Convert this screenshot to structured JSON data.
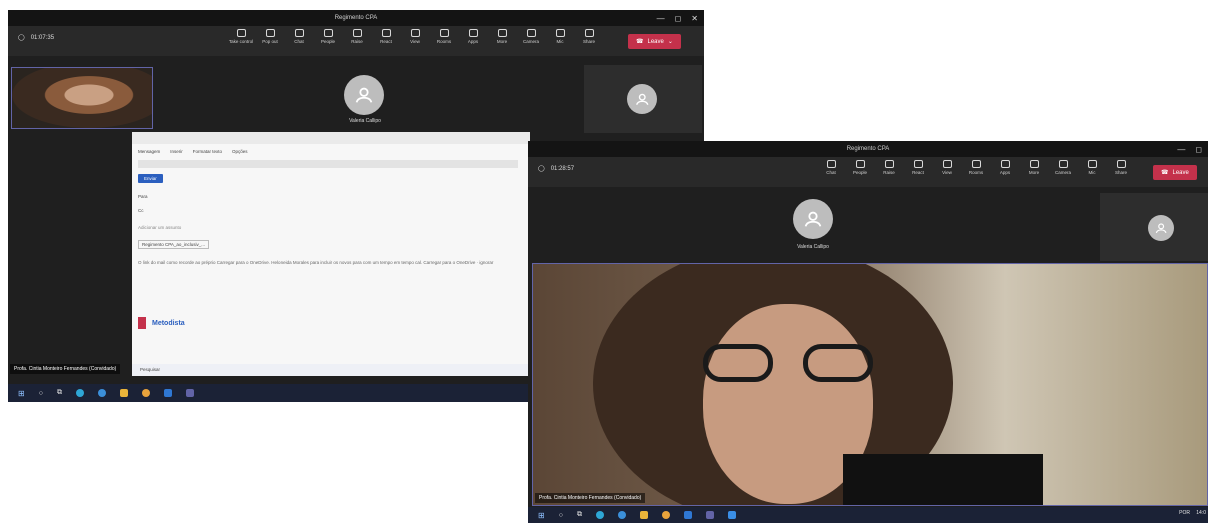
{
  "window": {
    "title": "Regimento CPA",
    "min": "—",
    "max": "◻",
    "close": "✕"
  },
  "left": {
    "timer": "01:07:35",
    "toolbar": [
      {
        "label": "Take control",
        "icon": "take-control-icon"
      },
      {
        "label": "Pop out",
        "icon": "popout-icon"
      },
      {
        "label": "Chat",
        "icon": "chat-icon"
      },
      {
        "label": "People",
        "icon": "people-icon"
      },
      {
        "label": "Raise",
        "icon": "hand-icon"
      },
      {
        "label": "React",
        "icon": "smiley-icon"
      },
      {
        "label": "View",
        "icon": "grid-icon"
      },
      {
        "label": "Rooms",
        "icon": "rooms-icon"
      },
      {
        "label": "Apps",
        "icon": "apps-icon"
      },
      {
        "label": "More",
        "icon": "more-icon"
      },
      {
        "label": "Camera",
        "icon": "camera-icon"
      },
      {
        "label": "Mic",
        "icon": "mic-icon"
      },
      {
        "label": "Share",
        "icon": "share-icon"
      }
    ],
    "leave": "Leave",
    "participant": "Valeria Callipo",
    "self_name": "Profa. Cintia Monteiro Fernandes (Convidado)",
    "email": {
      "tabs": [
        "Mensagem",
        "Inserir",
        "Formatar texto",
        "Opções"
      ],
      "send": "Enviar",
      "to_label": "Para",
      "cc_label": "Cc",
      "subject_placeholder": "Adicionar um assunto",
      "attachment": "Regimento CPA_ao_inclusiv_...",
      "body": "O link do mail como recorde ao préprio Carregar para o OneDrive. Heloneida Morales para incluir os novos para com um tempo em tempo cal. Carregar para o OneDrive · ignorar",
      "brand": "Metodista",
      "search": "Pesquisar"
    }
  },
  "right": {
    "title": "Regimento CPA",
    "timer": "01:28:57",
    "toolbar": [
      {
        "label": "Chat",
        "icon": "chat-icon"
      },
      {
        "label": "People",
        "icon": "people-icon"
      },
      {
        "label": "Raise",
        "icon": "hand-icon"
      },
      {
        "label": "React",
        "icon": "smiley-icon"
      },
      {
        "label": "View",
        "icon": "grid-icon"
      },
      {
        "label": "Rooms",
        "icon": "rooms-icon"
      },
      {
        "label": "Apps",
        "icon": "apps-icon"
      },
      {
        "label": "More",
        "icon": "more-icon"
      },
      {
        "label": "Camera",
        "icon": "camera-icon"
      },
      {
        "label": "Mic",
        "icon": "mic-icon"
      },
      {
        "label": "Share",
        "icon": "share-icon"
      }
    ],
    "leave": "Leave",
    "participant": "Valeria Callipo",
    "speaker": "Profa. Cintia Monteiro Fernandes (Convidado)",
    "tray": {
      "lang": "POR",
      "time": "14:0"
    }
  },
  "colors": {
    "leave": "#c4314b",
    "accent": "#6264a7",
    "taskbar": "#1b2236"
  }
}
